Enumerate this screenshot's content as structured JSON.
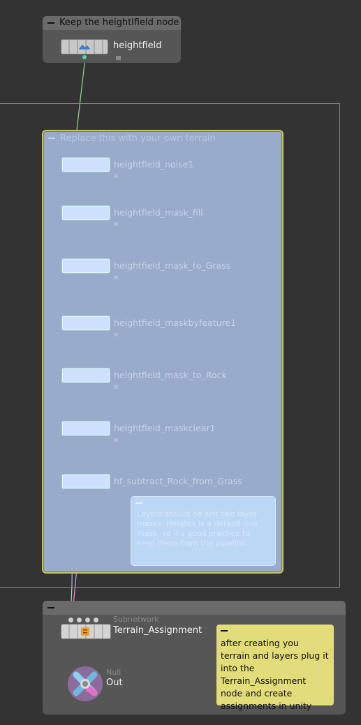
{
  "boxes": {
    "keep": {
      "title": "Keep the heightlfield node"
    },
    "terrain": {
      "title": "Replace this with your own terrain"
    },
    "assignment": {
      "title": ""
    }
  },
  "nodes": {
    "heightfield": {
      "label": "heightfield"
    },
    "chain": [
      {
        "label": "heightfield_noise1"
      },
      {
        "label": "heightfield_mask_fill"
      },
      {
        "label": "heightfield_mask_to_Grass"
      },
      {
        "label": "heightfield_maskbyfeature1"
      },
      {
        "label": "heightfield_mask_to_Rock"
      },
      {
        "label": "heightfield_maskclear1"
      },
      {
        "label": "hf_subtract_Rock_from_Grass"
      }
    ],
    "terrain_assignment": {
      "type_label": "Subnetwork",
      "label": "Terrain_Assignment"
    },
    "out": {
      "type_label": "Null",
      "label": "Out"
    }
  },
  "notes": {
    "terrain_note": "Layers should be just two layer masks. Heights is a default one mask, so it's good practice to keep them from the pipeline.",
    "assignment_note": "after creating you terrain and layers plug it into the Terrain_Assignment node and create assignments in unity"
  },
  "colors": {
    "background": "#333333",
    "netbox": "#565656",
    "terrain_box": "#98abcb",
    "terrain_border": "#c4c35c",
    "sticky_yellow": "#e3dc7a",
    "wire_green": "#8fd88f",
    "wire_pink": "#e07ad0"
  },
  "icons": [
    "heightfield-icon",
    "subnetwork-icon",
    "null-icon",
    "collapse-icon"
  ]
}
